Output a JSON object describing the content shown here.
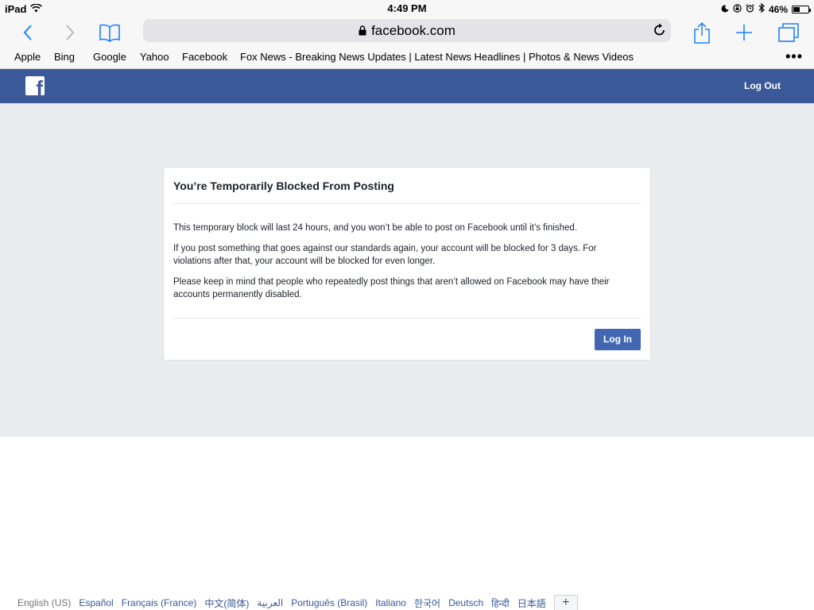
{
  "statusbar": {
    "device": "iPad",
    "time": "4:49 PM",
    "battery": "46%",
    "battery_level": 0.46
  },
  "browser": {
    "url": "facebook.com",
    "favorites": [
      "Apple",
      "Bing",
      "Google",
      "Yahoo",
      "Facebook",
      "Fox News - Breaking News Updates | Latest News Headlines | Photos & News Videos"
    ],
    "more": "•••"
  },
  "header": {
    "logo": "f",
    "logout_label": "Log Out",
    "brand_color": "#3b5998"
  },
  "dialog": {
    "title": "You’re Temporarily Blocked From Posting",
    "paragraphs": [
      "This temporary block will last 24 hours, and you won’t be able to post on Facebook until it’s finished.",
      "If you post something that goes against our standards again, your account will be blocked for 3 days. For violations after that, your account will be blocked for even longer.",
      "Please keep in mind that people who repeatedly post things that aren’t allowed on Facebook may have their accounts permanently disabled."
    ],
    "login_label": "Log In"
  },
  "footer": {
    "languages": [
      "English (US)",
      "Español",
      "Français (France)",
      "中文(简体)",
      "العربية",
      "Português (Brasil)",
      "Italiano",
      "한국어",
      "Deutsch",
      "हिन्दी",
      "日本語"
    ],
    "add_language": "+"
  }
}
